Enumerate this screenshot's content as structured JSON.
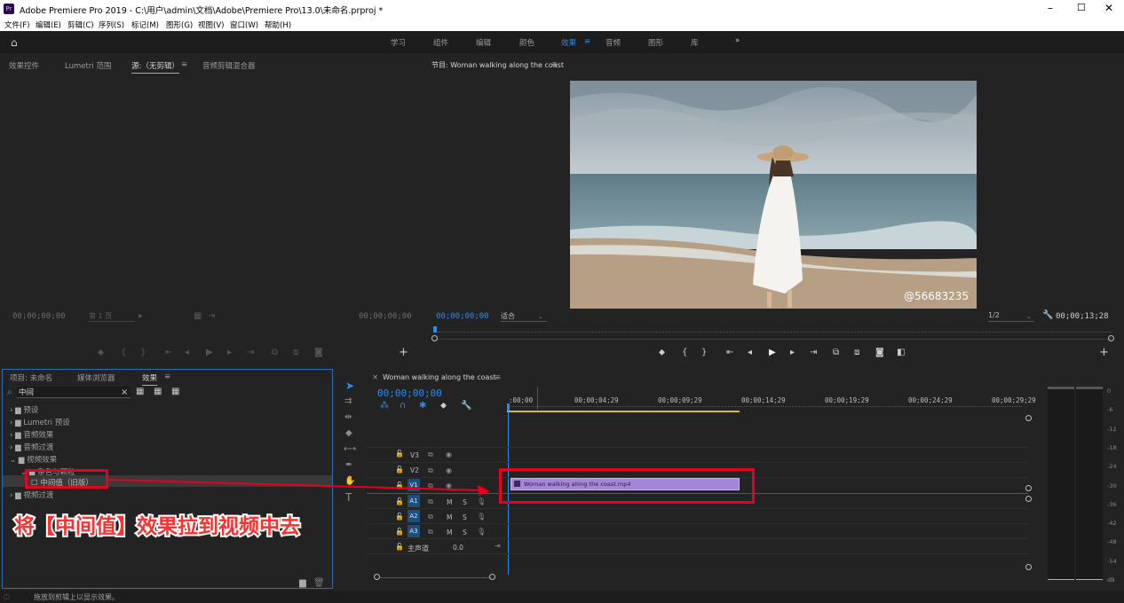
{
  "titlebar": {
    "app_icon": "Pr",
    "title": "Adobe Premiere Pro 2019 - C:\\用户\\admin\\文档\\Adobe\\Premiere Pro\\13.0\\未命名.prproj *"
  },
  "menu": [
    "文件(F)",
    "编辑(E)",
    "剪辑(C)",
    "序列(S)",
    "标记(M)",
    "图形(G)",
    "视图(V)",
    "窗口(W)",
    "帮助(H)"
  ],
  "workspaces": [
    "学习",
    "组件",
    "编辑",
    "颜色",
    "效果",
    "音频",
    "图形",
    "库"
  ],
  "source_panel": {
    "tabs": [
      "效果控件",
      "Lumetri 范围",
      "源:（无剪辑）",
      "音频剪辑混合器"
    ],
    "tc_left": "00;00;00;00",
    "zoom": "第 1 页",
    "tc_right": "00;00;00;00"
  },
  "program_panel": {
    "title": "节目: Woman walking along the coast",
    "watermark": "@56683235",
    "tc_left": "00;00;00;00",
    "fit": "适合",
    "res": "1/2",
    "tc_right": "00;00;13;28"
  },
  "project_panel": {
    "tabs": [
      "项目: 未命名",
      "媒体浏览器",
      "效果"
    ],
    "search": "中间",
    "tree": [
      "预设",
      "Lumetri 预设",
      "音频效果",
      "音频过渡",
      "视频效果",
      "杂色与颗粒",
      "中间值（旧版）",
      "视频过渡"
    ]
  },
  "timeline": {
    "title": "Woman walking along the coast",
    "tc": "00;00;00;00",
    "ruler": [
      ":00;00",
      "00;00;04;29",
      "00;00;09;29",
      "00;00;14;29",
      "00;00;19;29",
      "00;00;24;29",
      "00;00;29;29"
    ],
    "clip": "Woman walking along the coast.mp4",
    "tracks": [
      "V3",
      "V2",
      "V1",
      "A1",
      "A2",
      "A3"
    ],
    "master": "主声道",
    "master_val": "0.0"
  },
  "meter": [
    "0",
    "-6",
    "-12",
    "-18",
    "-24",
    "-30",
    "-36",
    "-42",
    "-48",
    "-54",
    "dB"
  ],
  "annotation": "将【中间值】效果拉到视频中去",
  "status": "拖放到剪辑上以显示效果。"
}
